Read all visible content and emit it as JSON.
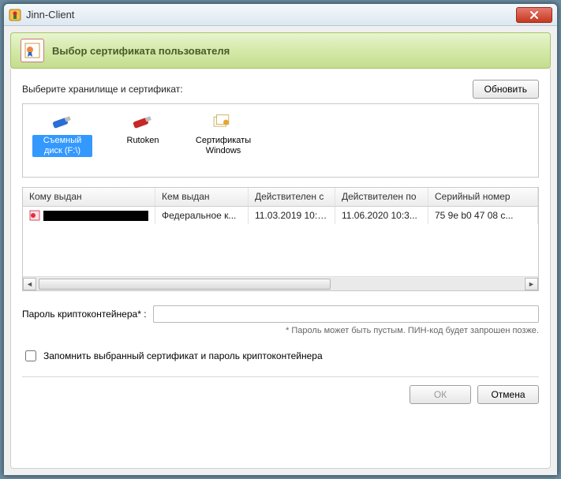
{
  "window": {
    "title": "Jinn-Client"
  },
  "header": {
    "title": "Выбор сертификата пользователя"
  },
  "prompt": "Выберите хранилище и сертификат:",
  "buttons": {
    "refresh": "Обновить",
    "ok": "ОК",
    "cancel": "Отмена"
  },
  "storage": {
    "items": [
      {
        "label": "Съемный диск (F:\\)",
        "icon": "usb-blue",
        "selected": true
      },
      {
        "label": "Rutoken",
        "icon": "usb-red",
        "selected": false
      },
      {
        "label": "Сертификаты Windows",
        "icon": "cert-stack",
        "selected": false
      }
    ]
  },
  "certTable": {
    "columns": [
      "Кому выдан",
      "Кем выдан",
      "Действителен с",
      "Действителен по",
      "Серийный номер"
    ],
    "rows": [
      {
        "issued_to": "[redacted]",
        "issued_by": "Федеральное к...",
        "valid_from": "11.03.2019 10:3...",
        "valid_to": "11.06.2020 10:3...",
        "serial": "75 9e b0 47 08 c..."
      }
    ]
  },
  "password": {
    "label": "Пароль криптоконтейнера* :",
    "value": "",
    "hint": "* Пароль может быть пустым. ПИН-код будет запрошен позже."
  },
  "remember": {
    "label": "Запомнить выбранный сертификат и пароль криптоконтейнера",
    "checked": false
  }
}
